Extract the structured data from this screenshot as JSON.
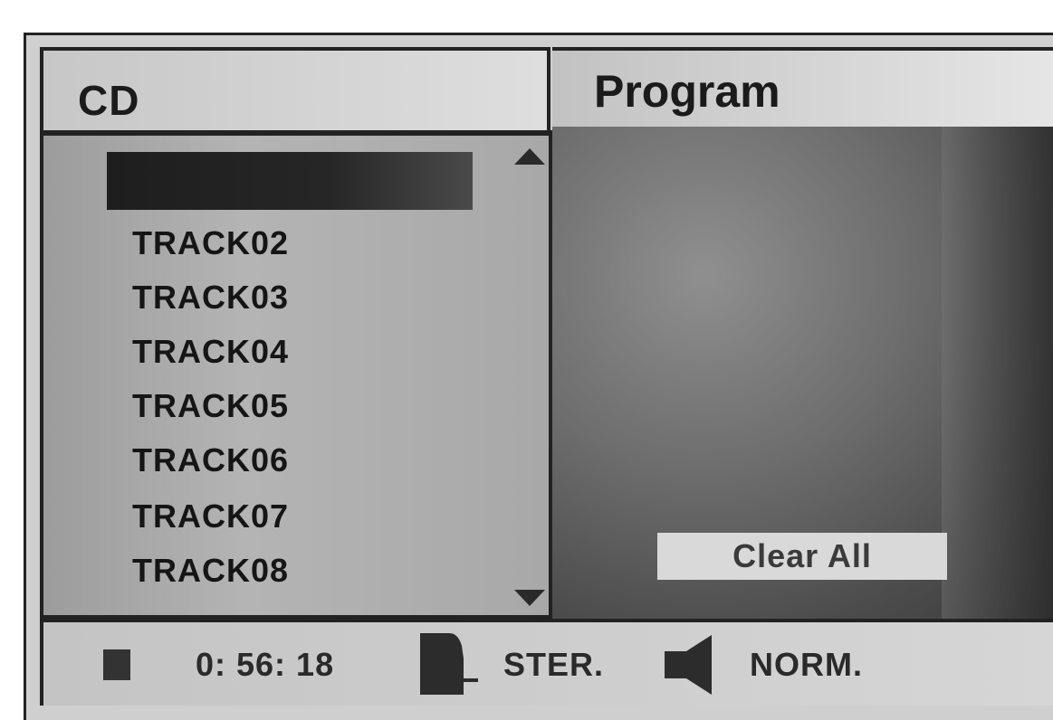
{
  "cd_panel": {
    "title": "CD",
    "tracks": [
      "TRACK02",
      "TRACK03",
      "TRACK04",
      "TRACK05",
      "TRACK06",
      "TRACK07",
      "TRACK08"
    ],
    "selected_index": 0
  },
  "program_panel": {
    "title": "Program",
    "clear_all_label": "Clear All"
  },
  "status_bar": {
    "play_state_icon": "stop-icon",
    "time": "0: 56: 18",
    "audio_icon": "audio-channel-icon",
    "audio_mode": "STER.",
    "sound_icon": "speaker-icon",
    "sound_mode": "NORM."
  },
  "colors": {
    "selection": "#1e1e1e",
    "list_background": "#a8a8a8",
    "frame": "#222222"
  }
}
